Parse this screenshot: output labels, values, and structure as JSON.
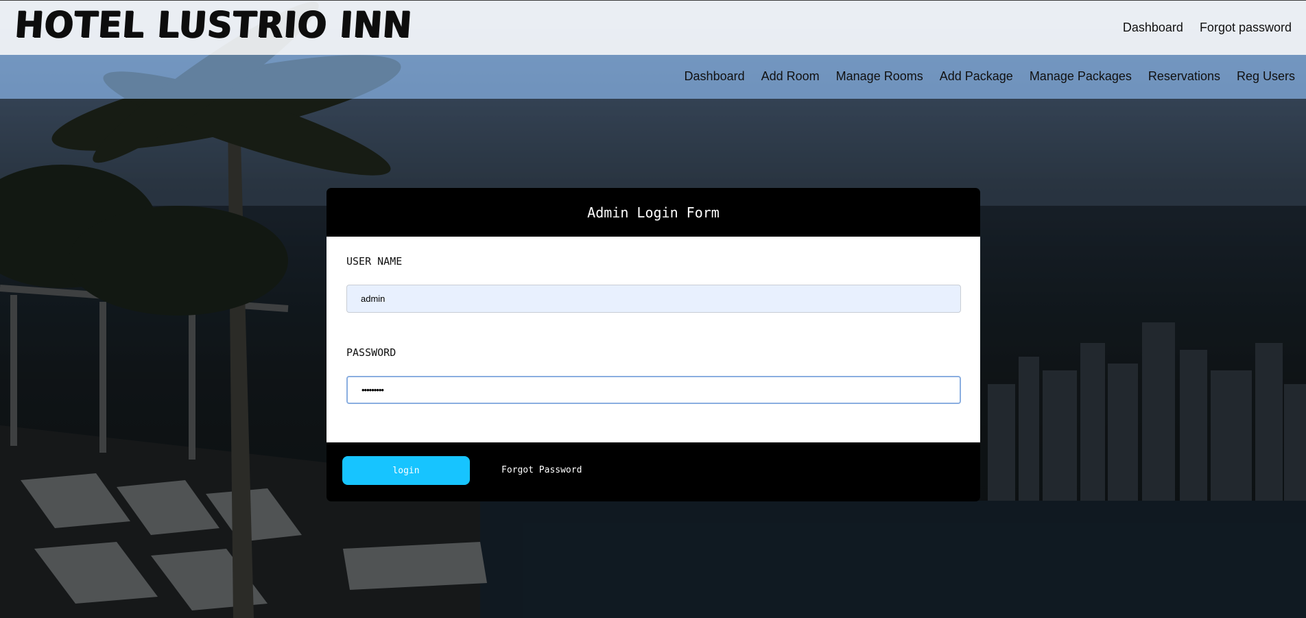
{
  "brand": {
    "name": "HOTEL LUSTRIO INN"
  },
  "top_links": [
    {
      "label": "Dashboard"
    },
    {
      "label": "Forgot password"
    }
  ],
  "nav": {
    "items": [
      {
        "label": "Dashboard"
      },
      {
        "label": "Add Room"
      },
      {
        "label": "Manage Rooms"
      },
      {
        "label": "Add Package"
      },
      {
        "label": "Manage Packages"
      },
      {
        "label": "Reservations"
      },
      {
        "label": "Reg Users"
      }
    ]
  },
  "form": {
    "title": "Admin Login Form",
    "username_label": "USER NAME",
    "username_value": "admin",
    "password_label": "PASSWORD",
    "password_value": "•••••••••",
    "login_label": "login",
    "forgot_label": "Forgot Password"
  },
  "colors": {
    "accent": "#17c4ff",
    "panel": "#000000",
    "autofill": "#e8f0fe"
  }
}
